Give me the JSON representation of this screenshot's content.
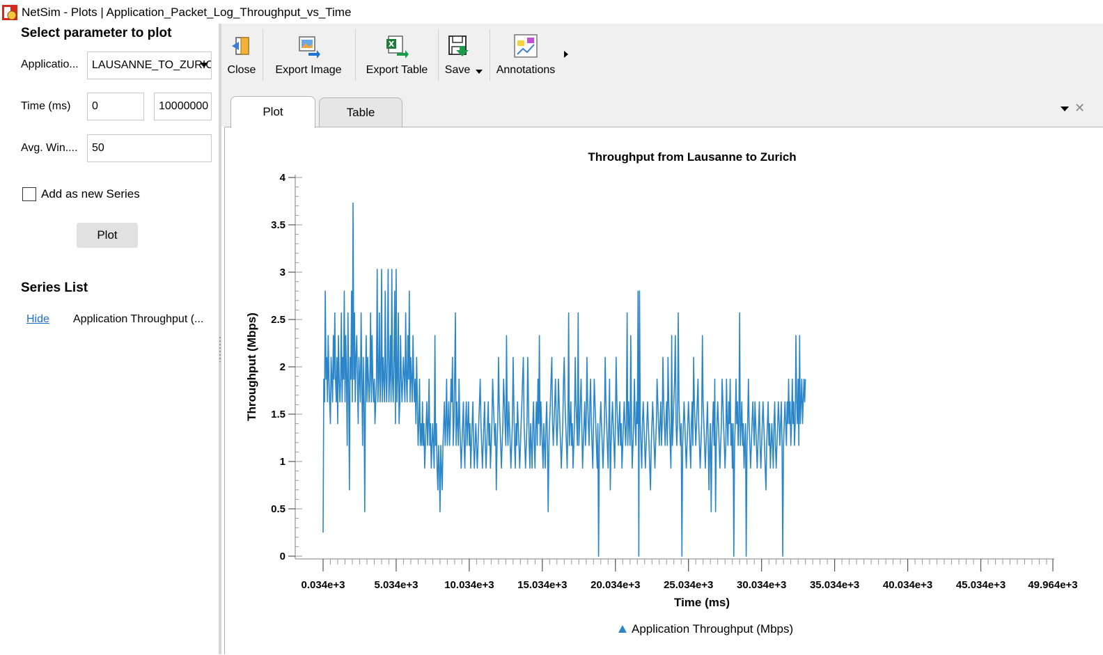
{
  "window": {
    "title": "NetSim - Plots | Application_Packet_Log_Throughput_vs_Time",
    "icon": "netsim-app-icon"
  },
  "left_panel": {
    "heading": "Select parameter to plot",
    "application_label": "Applicatio...",
    "application_value": "LAUSANNE_TO_ZURICH",
    "time_label": "Time (ms)",
    "time_start": "0",
    "time_end": "10000000",
    "avg_window_label": "Avg. Win....",
    "avg_window_value": "50",
    "add_series_label": "Add as new Series",
    "add_series_checked": false,
    "plot_button": "Plot",
    "series_list_heading": "Series List",
    "series": [
      {
        "action": "Hide",
        "name": "Application Throughput (..."
      }
    ]
  },
  "toolbar": {
    "items": [
      {
        "label": "Close",
        "icon": "close-exit-icon"
      },
      {
        "label": "Export Image",
        "icon": "export-image-icon"
      },
      {
        "label": "Export Table",
        "icon": "export-excel-icon"
      },
      {
        "label": "Save",
        "icon": "save-disk-icon"
      },
      {
        "label": "Annotations",
        "icon": "annotations-icon"
      }
    ]
  },
  "tabs": [
    {
      "label": "Plot",
      "active": true
    },
    {
      "label": "Table",
      "active": false
    }
  ],
  "colors": {
    "series": "#2a86c8",
    "toolbar_bg": "#f0f0f0",
    "link": "#1a6fd1"
  },
  "chart_data": {
    "type": "line",
    "title": "Throughput from Lausanne to Zurich",
    "xlabel": "Time (ms)",
    "ylabel": "Throughput (Mbps)",
    "xlim": [
      34,
      49964
    ],
    "ylim": [
      0,
      4
    ],
    "x_tick_labels": [
      "0.034e+3",
      "5.034e+3",
      "10.034e+3",
      "15.034e+3",
      "20.034e+3",
      "25.034e+3",
      "30.034e+3",
      "35.034e+3",
      "40.034e+3",
      "45.034e+3",
      "49.964e+3"
    ],
    "y_tick_labels": [
      "0",
      "0.5",
      "1",
      "1.5",
      "2",
      "2.5",
      "3",
      "3.5",
      "4"
    ],
    "y_ticks": [
      0,
      0.5,
      1,
      1.5,
      2,
      2.5,
      3,
      3.5,
      4
    ],
    "legend_position": "bottom",
    "series": [
      {
        "name": "Application Throughput (Mbps)",
        "x_start": 34,
        "x_step": 50,
        "values": [
          0.25,
          1.87,
          1.63,
          2.8,
          1.87,
          2.1,
          1.63,
          2.33,
          1.87,
          1.63,
          1.4,
          2.1,
          1.87,
          1.63,
          2.33,
          1.87,
          2.57,
          1.87,
          1.63,
          2.1,
          1.4,
          2.33,
          1.87,
          1.63,
          1.87,
          2.57,
          1.63,
          2.1,
          1.87,
          2.8,
          1.63,
          2.33,
          1.87,
          1.17,
          2.57,
          1.87,
          0.7,
          2.1,
          1.87,
          2.8,
          1.63,
          3.73,
          1.87,
          2.57,
          1.63,
          2.1,
          2.33,
          1.87,
          1.4,
          2.1,
          1.87,
          1.63,
          2.57,
          1.87,
          1.17,
          2.1,
          1.63,
          0.47,
          1.87,
          2.33,
          1.63,
          2.1,
          1.87,
          1.63,
          1.87,
          2.57,
          1.63,
          2.33,
          1.87,
          1.63,
          1.87,
          1.4,
          1.63,
          1.87,
          3.03,
          1.63,
          1.87,
          2.57,
          1.63,
          1.87,
          3.03,
          1.63,
          2.1,
          1.87,
          1.63,
          2.8,
          1.87,
          1.63,
          2.1,
          3.03,
          1.63,
          1.87,
          2.33,
          1.63,
          3.03,
          1.87,
          1.63,
          2.1,
          2.8,
          1.4,
          3.03,
          1.63,
          1.87,
          2.57,
          1.4,
          1.63,
          2.33,
          1.87,
          1.63,
          1.87,
          2.1,
          1.87,
          1.63,
          2.57,
          1.87,
          1.63,
          2.33,
          1.87,
          2.8,
          1.63,
          2.1,
          1.87,
          1.63,
          2.33,
          1.87,
          1.63,
          1.87,
          1.4,
          2.1,
          1.63,
          1.17,
          1.4,
          1.87,
          1.17,
          1.4,
          1.17,
          1.63,
          1.17,
          1.4,
          0.93,
          1.17,
          1.4,
          1.63,
          1.17,
          1.4,
          1.87,
          1.17,
          1.4,
          0.93,
          1.17,
          1.4,
          1.17,
          0.93,
          2.33,
          1.17,
          1.4,
          0.93,
          0.7,
          1.17,
          0.93,
          0.47,
          1.17,
          0.93,
          0.7,
          1.17,
          1.4,
          1.63,
          1.17,
          1.4,
          1.87,
          1.17,
          1.4,
          1.63,
          1.17,
          1.4,
          1.87,
          1.63,
          2.1,
          1.17,
          1.4,
          1.87,
          2.57,
          1.17,
          1.63,
          1.4,
          1.17,
          1.87,
          1.4,
          1.17,
          0.93,
          1.17,
          1.4,
          1.63,
          1.17,
          0.93,
          1.4,
          1.63,
          1.17,
          1.4,
          1.63,
          1.17,
          1.4,
          0.93,
          1.17,
          1.4,
          1.63,
          1.17,
          0.93,
          1.17,
          1.4,
          1.17,
          0.93,
          1.17,
          1.4,
          1.63,
          1.87,
          1.4,
          1.17,
          0.93,
          1.17,
          1.4,
          1.63,
          1.17,
          0.93,
          1.17,
          1.4,
          1.63,
          1.17,
          1.4,
          0.93,
          1.17,
          1.4,
          1.87,
          1.63,
          1.4,
          1.17,
          1.4,
          0.7,
          1.17,
          1.4,
          2.1,
          1.63,
          1.4,
          1.17,
          0.93,
          1.17,
          1.4,
          1.87,
          1.63,
          1.4,
          1.17,
          2.33,
          1.4,
          1.17,
          1.63,
          1.4,
          1.17,
          0.93,
          1.17,
          1.4,
          2.1,
          1.63,
          1.17,
          0.93,
          1.4,
          1.17,
          1.63,
          1.4,
          1.17,
          0.93,
          1.17,
          1.4,
          1.63,
          1.87,
          2.1,
          1.4,
          1.17,
          0.93,
          1.17,
          1.4,
          2.1,
          1.63,
          1.17,
          0.93,
          1.4,
          1.17,
          0.93,
          1.4,
          1.63,
          1.17,
          0.93,
          1.4,
          1.63,
          1.17,
          1.87,
          1.4,
          2.33,
          1.17,
          1.63,
          1.4,
          1.17,
          0.93,
          1.4,
          1.17,
          0.93,
          1.4,
          1.63,
          1.17,
          0.47,
          1.17,
          1.4,
          1.63,
          1.87,
          2.1,
          1.4,
          1.17,
          1.4,
          1.63,
          1.87,
          1.4,
          1.17,
          1.4,
          1.87,
          1.63,
          1.4,
          1.17,
          0.93,
          1.17,
          1.4,
          1.87,
          2.1,
          1.63,
          1.4,
          1.17,
          0.93,
          1.4,
          2.57,
          1.17,
          1.4,
          1.63,
          1.17,
          1.4,
          0.93,
          1.17,
          1.4,
          2.1,
          1.63,
          1.4,
          1.17,
          2.57,
          1.17,
          1.4,
          1.63,
          1.87,
          1.4,
          0.93,
          1.17,
          1.4,
          1.63,
          1.17,
          1.4,
          2.1,
          1.63,
          1.4,
          1.17,
          1.63,
          1.87,
          1.4,
          1.17,
          0.93,
          1.4,
          1.87,
          1.63,
          1.4,
          1.17,
          0.93,
          1.4,
          0.0,
          1.17,
          1.4,
          1.63,
          1.4,
          1.17,
          0.93,
          1.17,
          1.4,
          2.1,
          1.63,
          1.4,
          1.17,
          0.93,
          1.4,
          1.87,
          0.7,
          1.17,
          1.4,
          1.63,
          1.4,
          1.17,
          0.93,
          1.4,
          2.1,
          1.63,
          1.4,
          1.17,
          1.4,
          1.63,
          1.17,
          1.4,
          0.93,
          1.17,
          1.4,
          1.63,
          1.4,
          1.17,
          1.4,
          2.57,
          1.17,
          1.63,
          1.4,
          1.17,
          2.33,
          1.4,
          0.93,
          1.17,
          1.4,
          1.87,
          1.4,
          1.17,
          1.63,
          1.4,
          2.8,
          0.0,
          2.8,
          1.4,
          1.17,
          0.93,
          1.4,
          1.63,
          1.4,
          1.17,
          0.93,
          1.17,
          1.4,
          1.63,
          1.4,
          1.17,
          0.93,
          0.7,
          1.17,
          1.4,
          1.63,
          1.4,
          1.17,
          0.93,
          1.17,
          1.4,
          1.87,
          1.63,
          1.4,
          1.17,
          1.4,
          1.63,
          1.17,
          1.4,
          2.1,
          1.63,
          1.4,
          1.17,
          1.4,
          1.63,
          1.17,
          2.1,
          1.63,
          1.4,
          1.17,
          0.93,
          2.33,
          1.17,
          1.4,
          1.63,
          1.87,
          2.33,
          1.4,
          1.17,
          1.4,
          2.57,
          1.63,
          1.4,
          1.17,
          1.4,
          0.0,
          1.17,
          1.4,
          1.63,
          1.4,
          1.17,
          0.93,
          1.17,
          1.4,
          1.63,
          1.4,
          1.17,
          0.93,
          1.4,
          1.63,
          1.17,
          2.1,
          1.63,
          1.4,
          1.17,
          1.4,
          1.63,
          1.87,
          1.4,
          1.17,
          0.93,
          1.17,
          1.4,
          2.33,
          1.63,
          1.4,
          1.17,
          0.93,
          1.17,
          1.4,
          1.63,
          1.17,
          0.7,
          1.17,
          1.4,
          0.47,
          1.17,
          1.4,
          1.63,
          1.17,
          1.87,
          0.47,
          1.17,
          1.4,
          1.63,
          1.4,
          1.17,
          0.93,
          1.17,
          1.4,
          1.87,
          1.63,
          1.4,
          1.17,
          0.93,
          1.17,
          1.87,
          1.4,
          1.17,
          1.63,
          1.4,
          1.87,
          1.17,
          1.4,
          0.93,
          1.4,
          0.0,
          1.17,
          1.4,
          1.87,
          1.4,
          1.63,
          1.17,
          1.4,
          2.57,
          1.17,
          1.4,
          1.63,
          1.17,
          1.4,
          0.93,
          1.17,
          1.4,
          0.0,
          1.17,
          1.4,
          1.87,
          1.4,
          1.17,
          0.93,
          1.17,
          1.4,
          1.63,
          1.4,
          1.17,
          1.63,
          1.4,
          1.17,
          0.93,
          1.17,
          1.4,
          1.63,
          1.17,
          0.93,
          1.17,
          1.4,
          1.63,
          1.4,
          1.17,
          0.93,
          0.7,
          1.17,
          1.4,
          1.63,
          1.17,
          1.4,
          0.93,
          1.17,
          1.4,
          1.17,
          0.93,
          1.4,
          1.63,
          1.17,
          0.93,
          1.17,
          1.4,
          1.63,
          1.4,
          1.17,
          1.4,
          1.63,
          1.17,
          0.0,
          1.17,
          1.4,
          1.63,
          1.4,
          1.17,
          1.63,
          1.4,
          1.87,
          1.4,
          1.63,
          1.17,
          1.4,
          1.87,
          1.4,
          1.63,
          1.17,
          1.4,
          2.33,
          1.63,
          1.4,
          1.87,
          1.17,
          2.33,
          1.4,
          1.63,
          1.87,
          1.4,
          1.63,
          1.87,
          1.63,
          1.87
        ]
      }
    ]
  }
}
